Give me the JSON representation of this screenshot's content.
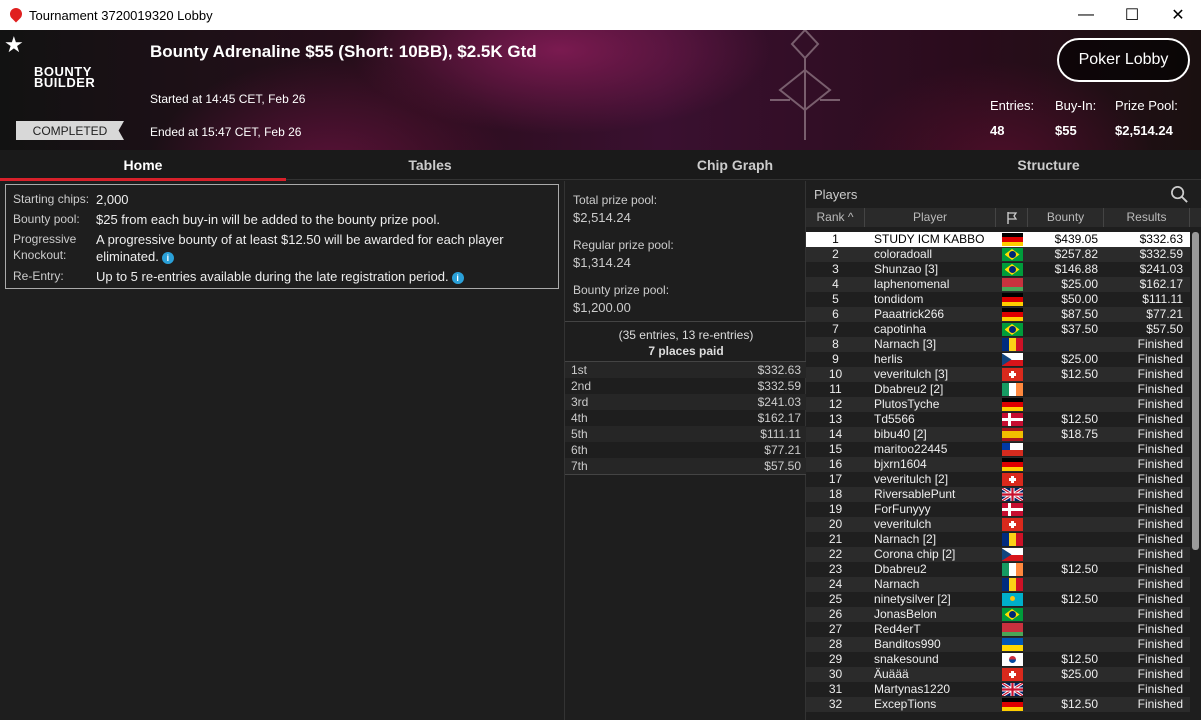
{
  "window": {
    "title": "Tournament 3720019320 Lobby",
    "minimize": "—",
    "maximize": "☐",
    "close": "✕"
  },
  "banner": {
    "logo_line1": "BOUNTY",
    "logo_line2": "BUILDER",
    "event_title": "Bounty Adrenaline $55 (Short: 10BB), $2.5K Gtd",
    "started": "Started at 14:45 CET, Feb 26",
    "ended": "Ended at 15:47 CET, Feb 26",
    "status": "COMPLETED",
    "poker_lobby_label": "Poker Lobby",
    "entries_label": "Entries:",
    "entries_value": "48",
    "buyin_label": "Buy-In:",
    "buyin_value": "$55",
    "prizepool_label": "Prize Pool:",
    "prizepool_value": "$2,514.24"
  },
  "tabs": [
    "Home",
    "Tables",
    "Chip Graph",
    "Structure"
  ],
  "info": {
    "starting_chips_key": "Starting chips:",
    "starting_chips_val": "2,000",
    "bounty_pool_key": "Bounty pool:",
    "bounty_pool_val": "$25 from each buy-in will be added to the bounty prize pool.",
    "progressive_key": "Progressive Knockout:",
    "progressive_val": "A progressive bounty of at least $12.50 will be awarded for each player eliminated.",
    "reentry_key": "Re-Entry:",
    "reentry_val": "Up to 5 re-entries available during the late registration period."
  },
  "prize": {
    "total_label": "Total prize pool:",
    "total_value": "$2,514.24",
    "regular_label": "Regular prize pool:",
    "regular_value": "$1,314.24",
    "bounty_label": "Bounty prize pool:",
    "bounty_value": "$1,200.00",
    "entries_note": "(35 entries, 13 re-entries)",
    "places_paid": "7 places paid",
    "payouts": [
      {
        "place": "1st",
        "amount": "$332.63"
      },
      {
        "place": "2nd",
        "amount": "$332.59"
      },
      {
        "place": "3rd",
        "amount": "$241.03"
      },
      {
        "place": "4th",
        "amount": "$162.17"
      },
      {
        "place": "5th",
        "amount": "$111.11"
      },
      {
        "place": "6th",
        "amount": "$77.21"
      },
      {
        "place": "7th",
        "amount": "$57.50"
      }
    ]
  },
  "players": {
    "title": "Players",
    "columns": {
      "rank": "Rank",
      "rank_sort": "^",
      "player": "Player",
      "bounty": "Bounty",
      "results": "Results"
    },
    "rows": [
      {
        "rank": "1",
        "name": "STUDY ICM KABBO",
        "flag": "de",
        "bounty": "$439.05",
        "result": "$332.63"
      },
      {
        "rank": "2",
        "name": "coloradoall",
        "flag": "br",
        "bounty": "$257.82",
        "result": "$332.59"
      },
      {
        "rank": "3",
        "name": "Shunzao [3]",
        "flag": "br",
        "bounty": "$146.88",
        "result": "$241.03"
      },
      {
        "rank": "4",
        "name": "laphenomenal",
        "flag": "by",
        "bounty": "$25.00",
        "result": "$162.17"
      },
      {
        "rank": "5",
        "name": "tondidom",
        "flag": "de",
        "bounty": "$50.00",
        "result": "$111.11"
      },
      {
        "rank": "6",
        "name": "Paaatrick266",
        "flag": "de",
        "bounty": "$87.50",
        "result": "$77.21"
      },
      {
        "rank": "7",
        "name": "capotinha",
        "flag": "br",
        "bounty": "$37.50",
        "result": "$57.50"
      },
      {
        "rank": "8",
        "name": "Narnach [3]",
        "flag": "ro",
        "bounty": "",
        "result": "Finished"
      },
      {
        "rank": "9",
        "name": "herlis",
        "flag": "cz",
        "bounty": "$25.00",
        "result": "Finished"
      },
      {
        "rank": "10",
        "name": "veveritulch [3]",
        "flag": "ch",
        "bounty": "$12.50",
        "result": "Finished"
      },
      {
        "rank": "11",
        "name": "Dbabreu2 [2]",
        "flag": "ie",
        "bounty": "",
        "result": "Finished"
      },
      {
        "rank": "12",
        "name": "PlutosTyche",
        "flag": "de",
        "bounty": "",
        "result": "Finished"
      },
      {
        "rank": "13",
        "name": "Td5566",
        "flag": "dk",
        "bounty": "$12.50",
        "result": "Finished"
      },
      {
        "rank": "14",
        "name": "bibu40 [2]",
        "flag": "es",
        "bounty": "$18.75",
        "result": "Finished"
      },
      {
        "rank": "15",
        "name": "maritoo22445",
        "flag": "cl",
        "bounty": "",
        "result": "Finished"
      },
      {
        "rank": "16",
        "name": "bjxrn1604",
        "flag": "de",
        "bounty": "",
        "result": "Finished"
      },
      {
        "rank": "17",
        "name": "veveritulch [2]",
        "flag": "ch",
        "bounty": "",
        "result": "Finished"
      },
      {
        "rank": "18",
        "name": "RiversablePunt",
        "flag": "gb",
        "bounty": "",
        "result": "Finished"
      },
      {
        "rank": "19",
        "name": "ForFunyyy",
        "flag": "dk",
        "bounty": "",
        "result": "Finished"
      },
      {
        "rank": "20",
        "name": "veveritulch",
        "flag": "ch",
        "bounty": "",
        "result": "Finished"
      },
      {
        "rank": "21",
        "name": "Narnach [2]",
        "flag": "ro",
        "bounty": "",
        "result": "Finished"
      },
      {
        "rank": "22",
        "name": "Corona chip [2]",
        "flag": "cz",
        "bounty": "",
        "result": "Finished"
      },
      {
        "rank": "23",
        "name": "Dbabreu2",
        "flag": "ie",
        "bounty": "$12.50",
        "result": "Finished"
      },
      {
        "rank": "24",
        "name": "Narnach",
        "flag": "ro",
        "bounty": "",
        "result": "Finished"
      },
      {
        "rank": "25",
        "name": "ninetysilver [2]",
        "flag": "kz",
        "bounty": "$12.50",
        "result": "Finished"
      },
      {
        "rank": "26",
        "name": "JonasBelon",
        "flag": "br",
        "bounty": "",
        "result": "Finished"
      },
      {
        "rank": "27",
        "name": "Red4erT",
        "flag": "by",
        "bounty": "",
        "result": "Finished"
      },
      {
        "rank": "28",
        "name": "Banditos990",
        "flag": "ua",
        "bounty": "",
        "result": "Finished"
      },
      {
        "rank": "29",
        "name": "snakesound",
        "flag": "kr",
        "bounty": "$12.50",
        "result": "Finished"
      },
      {
        "rank": "30",
        "name": "Äuäää",
        "flag": "ch",
        "bounty": "$25.00",
        "result": "Finished"
      },
      {
        "rank": "31",
        "name": "Martynas1220",
        "flag": "gb",
        "bounty": "",
        "result": "Finished"
      },
      {
        "rank": "32",
        "name": "ExcepTions",
        "flag": "de",
        "bounty": "$12.50",
        "result": "Finished"
      }
    ]
  },
  "colors": {
    "accent_red": "#d8202a",
    "info_blue": "#2aa0d8",
    "selected_row": "#ffffff"
  }
}
